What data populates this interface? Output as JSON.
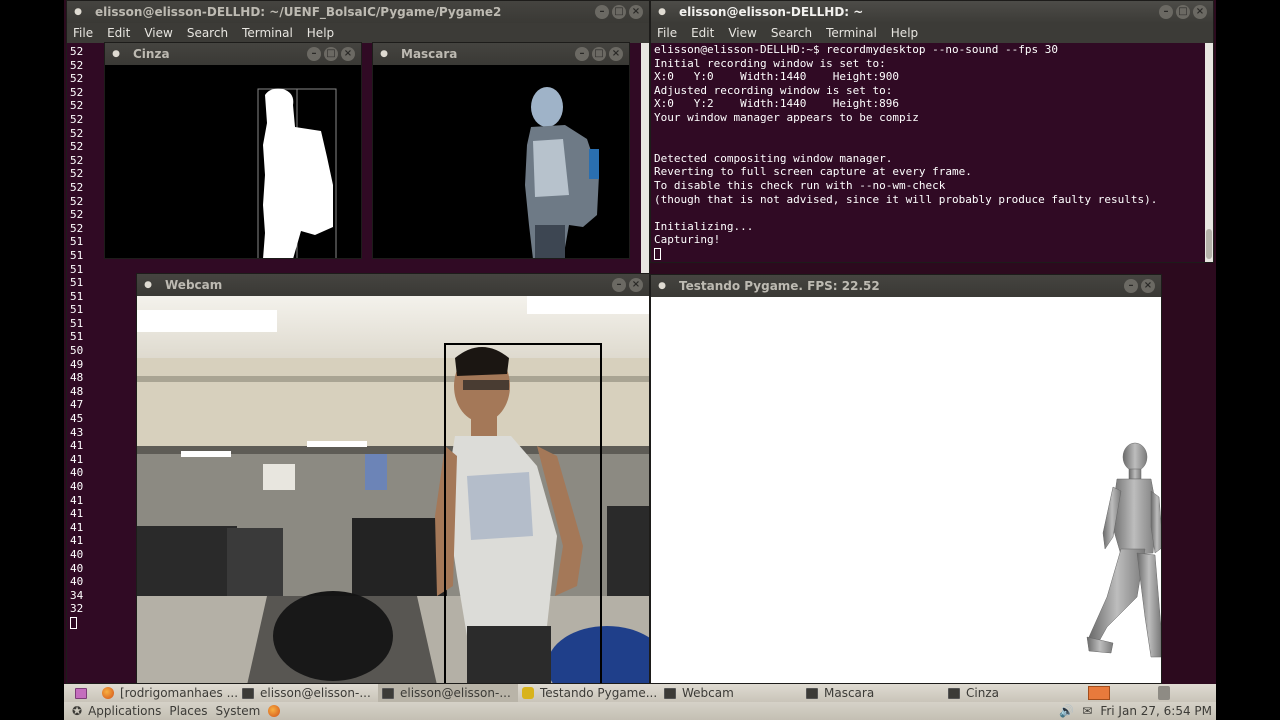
{
  "term_left": {
    "title": "elisson@elisson-DELLHD: ~/UENF_BolsaIC/Pygame/Pygame2",
    "menu": [
      "File",
      "Edit",
      "View",
      "Search",
      "Terminal",
      "Help"
    ],
    "lines": [
      "52",
      "52",
      "52",
      "52",
      "52",
      "52",
      "52",
      "52",
      "52",
      "52",
      "52",
      "52",
      "52",
      "52",
      "51",
      "51",
      "51",
      "51",
      "51",
      "51",
      "51",
      "51",
      "50",
      "49",
      "48",
      "48",
      "47",
      "45",
      "43",
      "41",
      "41",
      "40",
      "40",
      "41",
      "41",
      "41",
      "41",
      "40",
      "40",
      "40",
      "34",
      "32"
    ]
  },
  "term_right": {
    "title": "elisson@elisson-DELLHD: ~",
    "menu": [
      "File",
      "Edit",
      "View",
      "Search",
      "Terminal",
      "Help"
    ],
    "output": "elisson@elisson-DELLHD:~$ recordmydesktop --no-sound --fps 30\nInitial recording window is set to:\nX:0   Y:0    Width:1440    Height:900\nAdjusted recording window is set to:\nX:0   Y:2    Width:1440    Height:896\nYour window manager appears to be compiz\n\n\nDetected compositing window manager.\nReverting to full screen capture at every frame.\nTo disable this check run with --no-wm-check\n(though that is not advised, since it will probably produce faulty results).\n\nInitializing...\nCapturing!"
  },
  "cinza": {
    "title": "Cinza"
  },
  "mascara": {
    "title": "Mascara"
  },
  "webcam": {
    "title": "Webcam"
  },
  "pygame": {
    "title": "Testando Pygame. FPS: 22.52"
  },
  "taskbar": [
    {
      "label": "[rodrigomanhaes ...",
      "icon": "firefox-icon"
    },
    {
      "label": "elisson@elisson-...",
      "icon": "terminal-icon"
    },
    {
      "label": "elisson@elisson-...",
      "icon": "terminal-icon",
      "active": true
    },
    {
      "label": "Testando Pygame...",
      "icon": "python-icon"
    },
    {
      "label": "Webcam",
      "icon": "window-icon"
    },
    {
      "label": "Mascara",
      "icon": "window-icon"
    },
    {
      "label": "Cinza",
      "icon": "window-icon"
    }
  ],
  "top_panel": {
    "applications": "Applications",
    "places": "Places",
    "system": "System",
    "clock": "Fri Jan 27,  6:54 PM"
  },
  "colors": {
    "terminal_bg": "#300a24",
    "desktop_bg": "#2c0a1e",
    "titlebar": "#3c3b37",
    "panel": "#dfdbd2"
  }
}
